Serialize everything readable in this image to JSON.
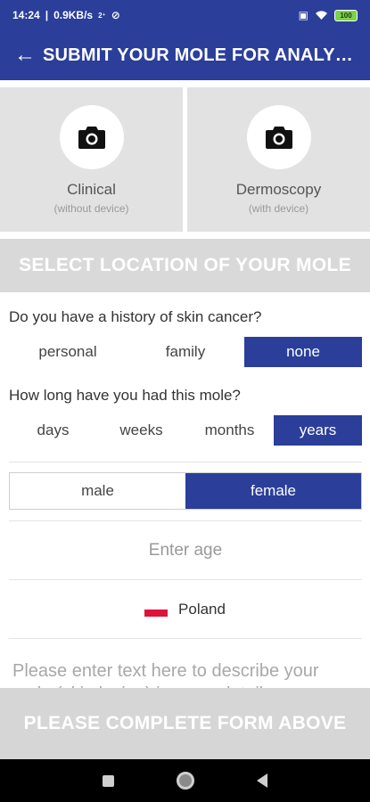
{
  "status_bar": {
    "time": "14:24",
    "speed": "0.9KB/s",
    "battery": "100"
  },
  "app_bar": {
    "title": "SUBMIT YOUR MOLE FOR ANALY…"
  },
  "photo_options": [
    {
      "label": "Clinical",
      "sub": "(without device)",
      "icon": "camera-icon"
    },
    {
      "label": "Dermoscopy",
      "sub": "(with device)",
      "icon": "camera-icon"
    }
  ],
  "location_banner": "SELECT LOCATION OF YOUR MOLE",
  "history": {
    "question": "Do you have a history of skin cancer?",
    "options": [
      "personal",
      "family",
      "none"
    ],
    "selected": "none"
  },
  "duration": {
    "question": "How long have you had this mole?",
    "options": [
      "days",
      "weeks",
      "months",
      "years"
    ],
    "selected": "years"
  },
  "gender": {
    "options": [
      "male",
      "female"
    ],
    "selected": "female"
  },
  "age": {
    "placeholder": "Enter age"
  },
  "country": {
    "name": "Poland"
  },
  "description": {
    "placeholder": "Please enter text here to describe your mole (skin lesion) in more detail"
  },
  "submit": {
    "label": "PLEASE COMPLETE FORM ABOVE"
  },
  "colors": {
    "primary": "#2a3e9a",
    "disabled": "#d6d6d6",
    "card": "#e2e2e2"
  }
}
